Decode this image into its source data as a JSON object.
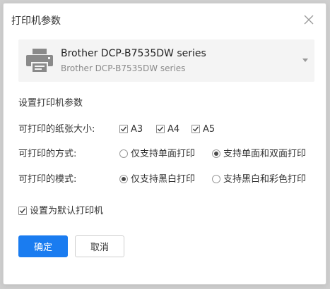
{
  "dialog": {
    "title": "打印机参数",
    "close_icon": "close-icon"
  },
  "printer": {
    "name": "Brother DCP-B7535DW series",
    "subtitle": "Brother DCP-B7535DW series",
    "icon": "printer-icon",
    "arrow_icon": "caret-down-icon"
  },
  "settings": {
    "heading": "设置打印机参数",
    "paper_size": {
      "label": "可打印的纸张大小:",
      "options": [
        {
          "label": "A3",
          "checked": true
        },
        {
          "label": "A4",
          "checked": true
        },
        {
          "label": "A5",
          "checked": true
        }
      ]
    },
    "print_mode": {
      "label": "可打印的方式:",
      "options": [
        {
          "label": "仅支持单面打印",
          "selected": false
        },
        {
          "label": "支持单面和双面打印",
          "selected": true
        }
      ]
    },
    "color_mode": {
      "label": "可打印的模式:",
      "options": [
        {
          "label": "仅支持黑白打印",
          "selected": true
        },
        {
          "label": "支持黑白和彩色打印",
          "selected": false
        }
      ]
    },
    "default_printer": {
      "label": "设置为默认打印机",
      "checked": true
    }
  },
  "buttons": {
    "confirm": "确定",
    "cancel": "取消"
  },
  "colors": {
    "primary": "#1a7cf0",
    "select_bg": "#f4f4f4",
    "text": "#333333"
  }
}
